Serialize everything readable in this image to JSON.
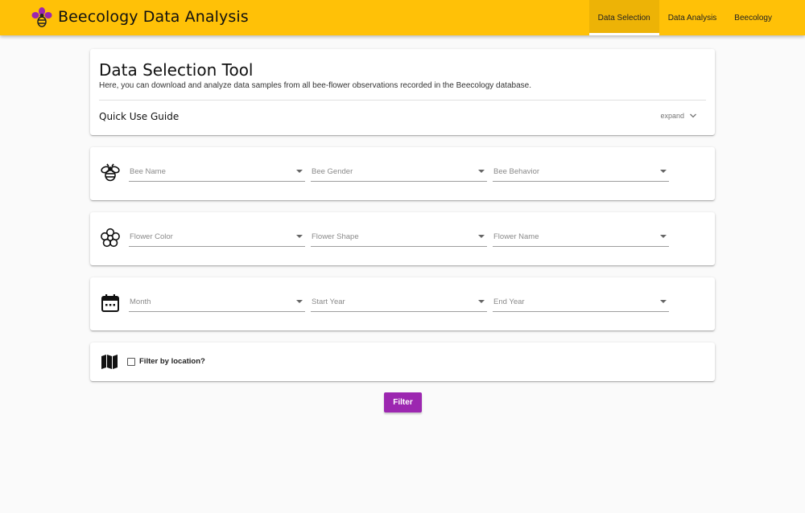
{
  "app": {
    "title": "Beecology Data Analysis",
    "logo_icon": "bee-flower-logo",
    "accent_color": "#ffc107",
    "logo_petal_color": "#9c27b0"
  },
  "nav": {
    "items": [
      {
        "label": "Data Selection",
        "active": true
      },
      {
        "label": "Data Analysis",
        "active": false
      },
      {
        "label": "Beecology",
        "active": false
      }
    ]
  },
  "intro": {
    "title": "Data Selection Tool",
    "description": "Here, you can download and analyze data samples from all bee-flower observations recorded in the Beecology database.",
    "guide_title": "Quick Use Guide",
    "expand_label": "expand"
  },
  "filters": {
    "bee": {
      "icon": "bee-icon",
      "fields": [
        {
          "placeholder": "Bee Name"
        },
        {
          "placeholder": "Bee Gender"
        },
        {
          "placeholder": "Bee Behavior"
        }
      ]
    },
    "flower": {
      "icon": "flower-icon",
      "fields": [
        {
          "placeholder": "Flower Color"
        },
        {
          "placeholder": "Flower Shape"
        },
        {
          "placeholder": "Flower Name"
        }
      ]
    },
    "date": {
      "icon": "calendar-icon",
      "fields": [
        {
          "placeholder": "Month"
        },
        {
          "placeholder": "Start Year"
        },
        {
          "placeholder": "End Year"
        }
      ]
    },
    "location": {
      "icon": "map-icon",
      "checkbox_label": "Filter by location?",
      "checked": false
    }
  },
  "actions": {
    "filter_label": "Filter",
    "filter_color": "#9c27b0"
  }
}
